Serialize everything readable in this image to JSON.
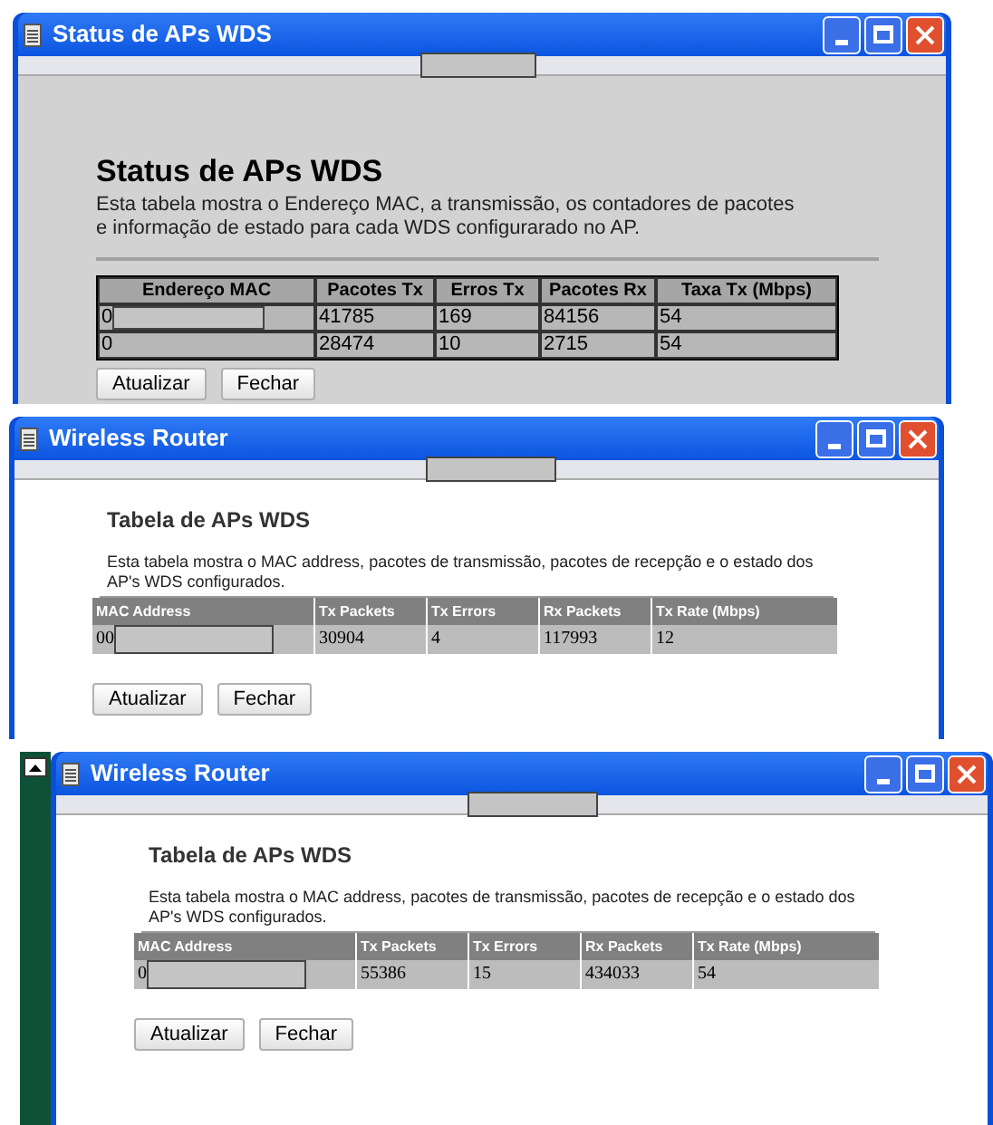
{
  "windows": [
    {
      "kind": "classic",
      "title": "Status de APs WDS",
      "heading": "Status de APs WDS",
      "description": [
        "Esta tabela mostra o Endereço MAC, a transmissão, os contadores de pacotes",
        "e informação de estado para cada WDS configurarado no AP."
      ],
      "columns": [
        "Endereço MAC",
        "Pacotes Tx",
        "Erros Tx",
        "Pacotes Rx",
        "Taxa Tx (Mbps)"
      ],
      "rows": [
        [
          "0",
          "41785",
          "169",
          "84156",
          "54"
        ],
        [
          "0",
          "28474",
          "10",
          "2715",
          "54"
        ]
      ],
      "buttons": [
        "Atualizar",
        "Fechar"
      ]
    },
    {
      "kind": "router",
      "title": "Wireless Router",
      "heading": "Tabela de APs WDS",
      "description": [
        "Esta tabela mostra o MAC address, pacotes de transmissão, pacotes de recepção e o estado dos AP's WDS configurados."
      ],
      "columns": [
        "MAC Address",
        "Tx Packets",
        "Tx Errors",
        "Rx Packets",
        "Tx Rate (Mbps)"
      ],
      "rows": [
        [
          "00",
          "30904",
          "4",
          "117993",
          "12"
        ]
      ],
      "buttons": [
        "Atualizar",
        "Fechar"
      ]
    },
    {
      "kind": "router",
      "title": "Wireless Router",
      "heading": "Tabela de APs WDS",
      "description": [
        "Esta tabela mostra o MAC address, pacotes de transmissão, pacotes de recepção e o estado dos AP's WDS configurados."
      ],
      "columns": [
        "MAC Address",
        "Tx Packets",
        "Tx Errors",
        "Rx Packets",
        "Tx Rate (Mbps)"
      ],
      "rows": [
        [
          "0",
          "55386",
          "15",
          "434033",
          "54"
        ]
      ],
      "buttons": [
        "Atualizar",
        "Fechar"
      ]
    }
  ]
}
